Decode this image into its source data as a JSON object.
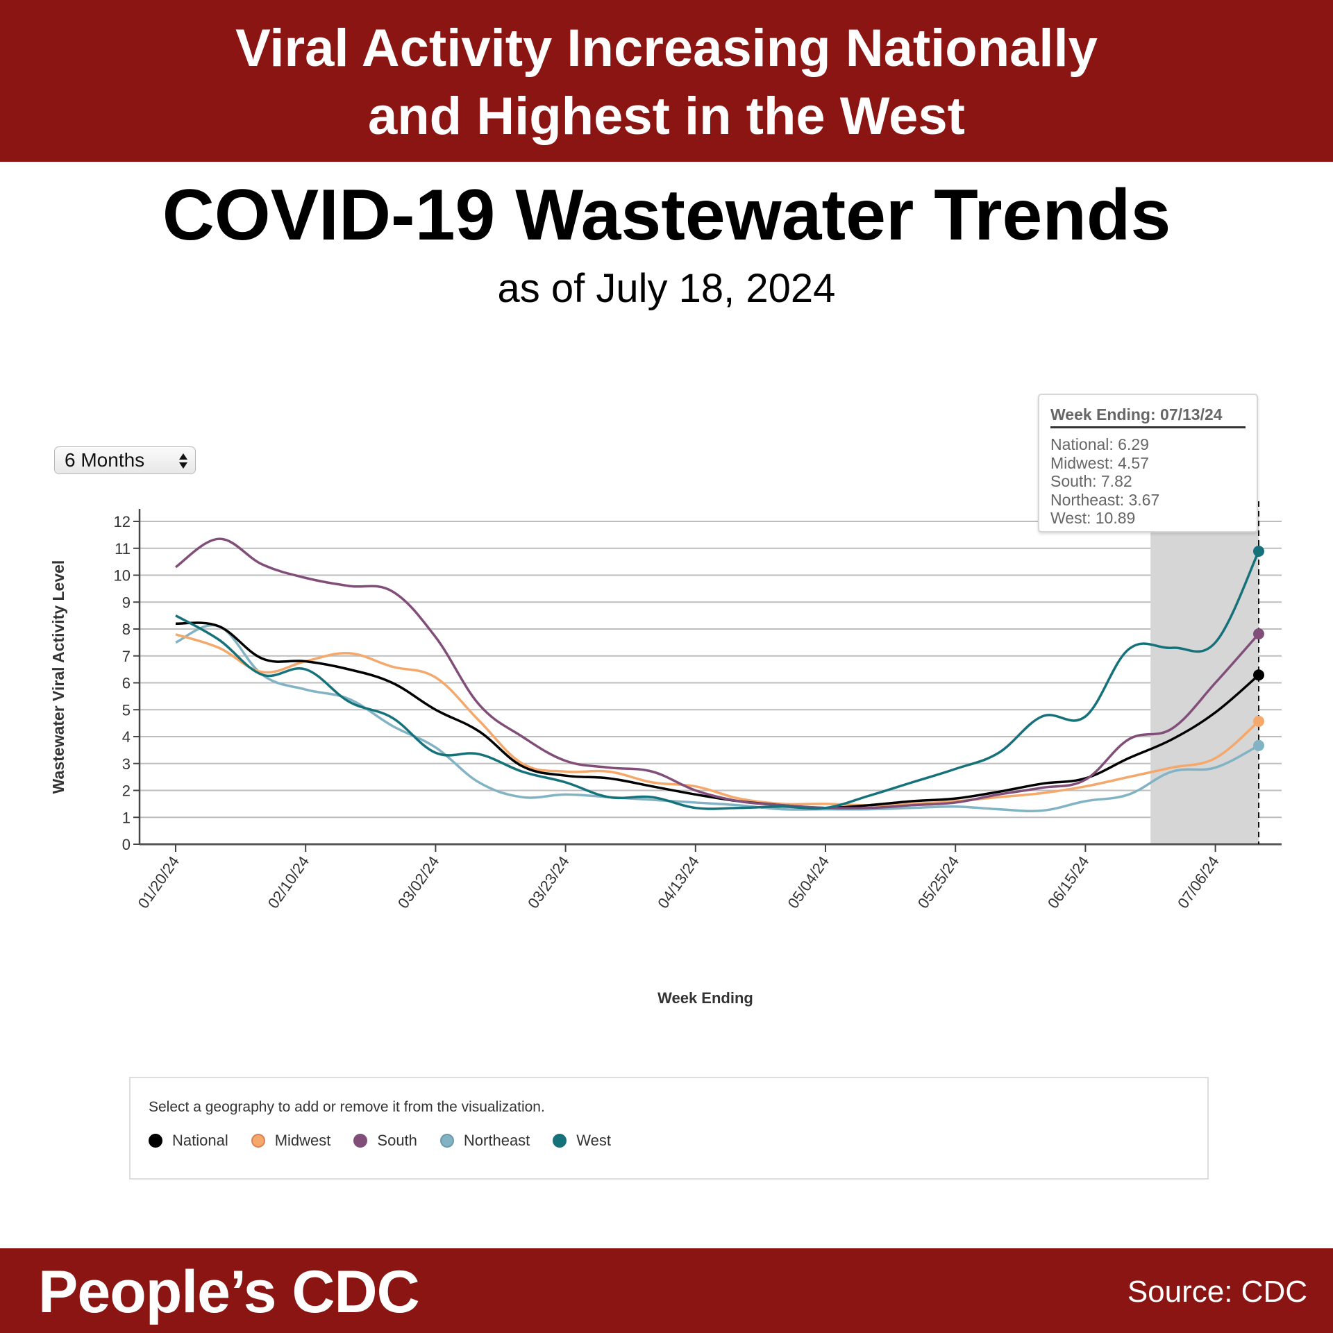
{
  "banner": {
    "line1": "Viral Activity Increasing Nationally",
    "line2": "and Highest in the West"
  },
  "title": "COVID-19 Wastewater Trends",
  "subtitle": "as of July 18, 2024",
  "time_range_select": {
    "value": "6 Months"
  },
  "tooltip": {
    "header": "Week Ending: 07/13/24",
    "rows": [
      "National: 6.29",
      "Midwest: 4.57",
      "South: 7.82",
      "Northeast: 3.67",
      "West: 10.89"
    ]
  },
  "legend": {
    "instruction": "Select a geography to add or remove it from the visualization.",
    "items": [
      {
        "label": "National",
        "color": "#000000"
      },
      {
        "label": "Midwest",
        "color": "#f5a86b"
      },
      {
        "label": "South",
        "color": "#804e79"
      },
      {
        "label": "Northeast",
        "color": "#82b3c4"
      },
      {
        "label": "West",
        "color": "#15717a"
      }
    ]
  },
  "footer": {
    "brand": "People’s CDC",
    "source": "Source: CDC"
  },
  "chart_data": {
    "type": "line",
    "title": "COVID-19 Wastewater Trends",
    "xlabel": "Week Ending",
    "ylabel": "Wastewater Viral Activity Level",
    "ylim": [
      0,
      12
    ],
    "yticks": [
      0,
      1,
      2,
      3,
      4,
      5,
      6,
      7,
      8,
      9,
      10,
      11,
      12
    ],
    "grid": true,
    "legend_position": "bottom",
    "x": [
      "01/20/24",
      "01/27/24",
      "02/03/24",
      "02/10/24",
      "02/17/24",
      "02/24/24",
      "03/02/24",
      "03/09/24",
      "03/16/24",
      "03/23/24",
      "03/30/24",
      "04/06/24",
      "04/13/24",
      "04/20/24",
      "04/27/24",
      "05/04/24",
      "05/11/24",
      "05/18/24",
      "05/25/24",
      "06/01/24",
      "06/08/24",
      "06/15/24",
      "06/22/24",
      "06/29/24",
      "07/06/24",
      "07/13/24"
    ],
    "xtick_labels": [
      "01/20/24",
      "02/10/24",
      "03/02/24",
      "03/23/24",
      "04/13/24",
      "05/04/24",
      "05/25/24",
      "06/15/24",
      "07/06/24"
    ],
    "highlight_range": [
      "06/29/24",
      "07/13/24"
    ],
    "hover_week": "07/13/24",
    "series": [
      {
        "name": "National",
        "color": "#000000",
        "values": [
          8.2,
          8.1,
          6.9,
          6.8,
          6.5,
          6.0,
          5.0,
          4.2,
          2.9,
          2.55,
          2.45,
          2.15,
          1.85,
          1.6,
          1.45,
          1.35,
          1.45,
          1.6,
          1.7,
          1.95,
          2.25,
          2.45,
          3.2,
          3.9,
          4.9,
          6.29
        ]
      },
      {
        "name": "Midwest",
        "color": "#f5a86b",
        "values": [
          7.8,
          7.3,
          6.4,
          6.8,
          7.1,
          6.6,
          6.2,
          4.6,
          3.0,
          2.7,
          2.7,
          2.3,
          2.15,
          1.7,
          1.5,
          1.5,
          1.45,
          1.5,
          1.6,
          1.75,
          1.9,
          2.15,
          2.5,
          2.85,
          3.2,
          4.57
        ]
      },
      {
        "name": "South",
        "color": "#804e79",
        "values": [
          10.3,
          11.35,
          10.4,
          9.9,
          9.6,
          9.4,
          7.7,
          5.2,
          4.0,
          3.1,
          2.85,
          2.7,
          2.0,
          1.6,
          1.45,
          1.35,
          1.35,
          1.45,
          1.55,
          1.85,
          2.1,
          2.4,
          3.9,
          4.3,
          6.0,
          7.82
        ]
      },
      {
        "name": "Northeast",
        "color": "#82b3c4",
        "values": [
          7.5,
          8.1,
          6.3,
          5.75,
          5.4,
          4.4,
          3.6,
          2.3,
          1.75,
          1.85,
          1.75,
          1.65,
          1.55,
          1.45,
          1.3,
          1.3,
          1.3,
          1.35,
          1.4,
          1.3,
          1.25,
          1.6,
          1.85,
          2.7,
          2.85,
          3.67
        ]
      },
      {
        "name": "West",
        "color": "#15717a",
        "values": [
          8.5,
          7.6,
          6.3,
          6.5,
          5.3,
          4.7,
          3.4,
          3.35,
          2.7,
          2.3,
          1.75,
          1.75,
          1.35,
          1.35,
          1.4,
          1.35,
          1.8,
          2.3,
          2.8,
          3.4,
          4.75,
          4.75,
          7.25,
          7.3,
          7.5,
          10.89
        ]
      }
    ]
  }
}
